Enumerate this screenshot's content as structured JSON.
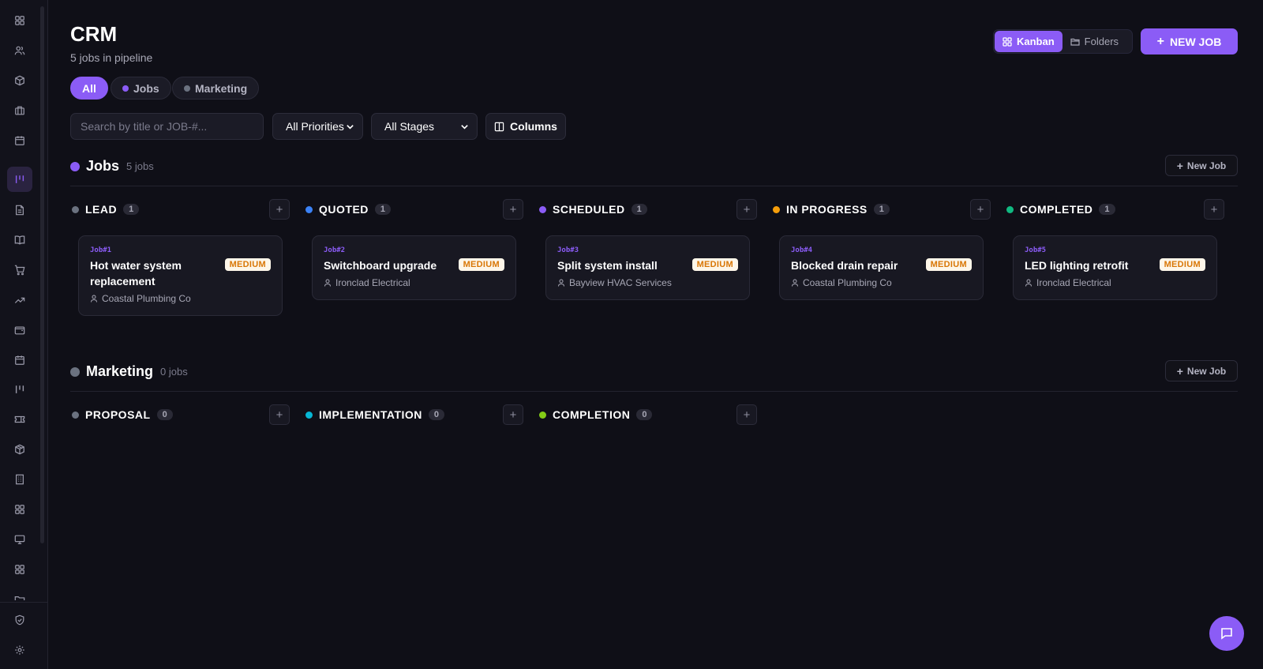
{
  "header": {
    "title": "CRM",
    "subtitle": "5 jobs in pipeline",
    "view_kanban": "Kanban",
    "view_folders": "Folders",
    "new_job": "NEW JOB"
  },
  "pills": {
    "all": "All",
    "jobs": "Jobs",
    "marketing": "Marketing"
  },
  "filters": {
    "search_placeholder": "Search by title or JOB-#...",
    "priority": "All Priorities",
    "stage": "All Stages",
    "columns": "Columns"
  },
  "sections": {
    "jobs": {
      "title": "Jobs",
      "count": "5 jobs",
      "new_label": "New Job",
      "columns": [
        {
          "title": "LEAD",
          "count": "1",
          "color": "#6b7280",
          "card": {
            "id": "Job#1",
            "title": "Hot water system replacement",
            "priority": "MEDIUM",
            "client": "Coastal Plumbing Co"
          }
        },
        {
          "title": "QUOTED",
          "count": "1",
          "color": "#3b82f6",
          "card": {
            "id": "Job#2",
            "title": "Switchboard upgrade",
            "priority": "MEDIUM",
            "client": "Ironclad Electrical"
          }
        },
        {
          "title": "SCHEDULED",
          "count": "1",
          "color": "#8b5cf6",
          "card": {
            "id": "Job#3",
            "title": "Split system install",
            "priority": "MEDIUM",
            "client": "Bayview HVAC Services"
          }
        },
        {
          "title": "IN PROGRESS",
          "count": "1",
          "color": "#f59e0b",
          "card": {
            "id": "Job#4",
            "title": "Blocked drain repair",
            "priority": "MEDIUM",
            "client": "Coastal Plumbing Co"
          }
        },
        {
          "title": "COMPLETED",
          "count": "1",
          "color": "#10b981",
          "card": {
            "id": "Job#5",
            "title": "LED lighting retrofit",
            "priority": "MEDIUM",
            "client": "Ironclad Electrical"
          }
        }
      ]
    },
    "marketing": {
      "title": "Marketing",
      "count": "0 jobs",
      "new_label": "New Job",
      "columns": [
        {
          "title": "PROPOSAL",
          "count": "0",
          "color": "#6b7280"
        },
        {
          "title": "IMPLEMENTATION",
          "count": "0",
          "color": "#06b6d4"
        },
        {
          "title": "COMPLETION",
          "count": "0",
          "color": "#84cc16"
        }
      ]
    }
  },
  "colors": {
    "accent": "#8b5cf6",
    "jobs_dot": "#8b5cf6",
    "marketing_dot": "#6b7280",
    "priority_medium": "#d97706"
  },
  "sidebar_icons": [
    "grid-icon",
    "users-icon",
    "box-icon",
    "briefcase-icon",
    "calendar-icon",
    "kanban-icon",
    "document-icon",
    "book-icon",
    "cart-icon",
    "trending-icon",
    "wallet-icon",
    "calendar-icon",
    "kanban-icon",
    "ticket-icon",
    "package-icon",
    "building-icon",
    "grid-icon",
    "monitor-icon",
    "grid-icon",
    "folder-icon"
  ]
}
